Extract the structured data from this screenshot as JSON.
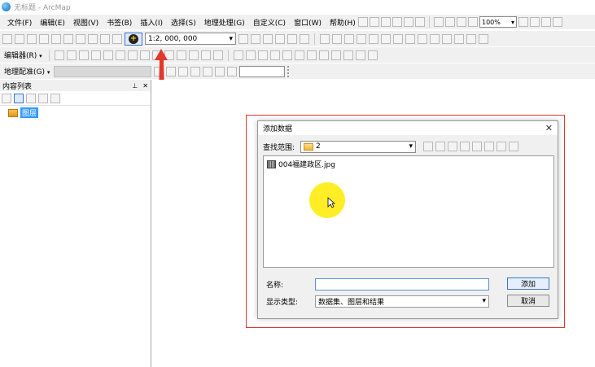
{
  "window": {
    "title": "无标题 - ArcMap"
  },
  "menu": {
    "items": [
      "文件(F)",
      "编辑(E)",
      "视图(V)",
      "书签(B)",
      "插入(I)",
      "选择(S)",
      "地理处理(G)",
      "自定义(C)",
      "窗口(W)",
      "帮助(H)"
    ]
  },
  "toolbar": {
    "scale": "1:2, 000, 000",
    "zoom": "100%",
    "editor_label": "编辑器(R)",
    "georef_label": "地理配准(G)"
  },
  "toc": {
    "title": "内容列表",
    "layers_label": "图层"
  },
  "dialog": {
    "title": "添加数据",
    "lookin_label": "查找范围:",
    "lookin_value": "2",
    "files": [
      "004福建政区.jpg"
    ],
    "name_label": "名称:",
    "name_value": "",
    "type_label": "显示类型:",
    "type_value": "数据集、图层和结果",
    "add_button": "添加",
    "cancel_button": "取消"
  },
  "colors": {
    "highlight_border": "#e0392b",
    "arrow": "#e0392b",
    "cursor_spot": "#ffeb00",
    "selection": "#3399ff"
  }
}
